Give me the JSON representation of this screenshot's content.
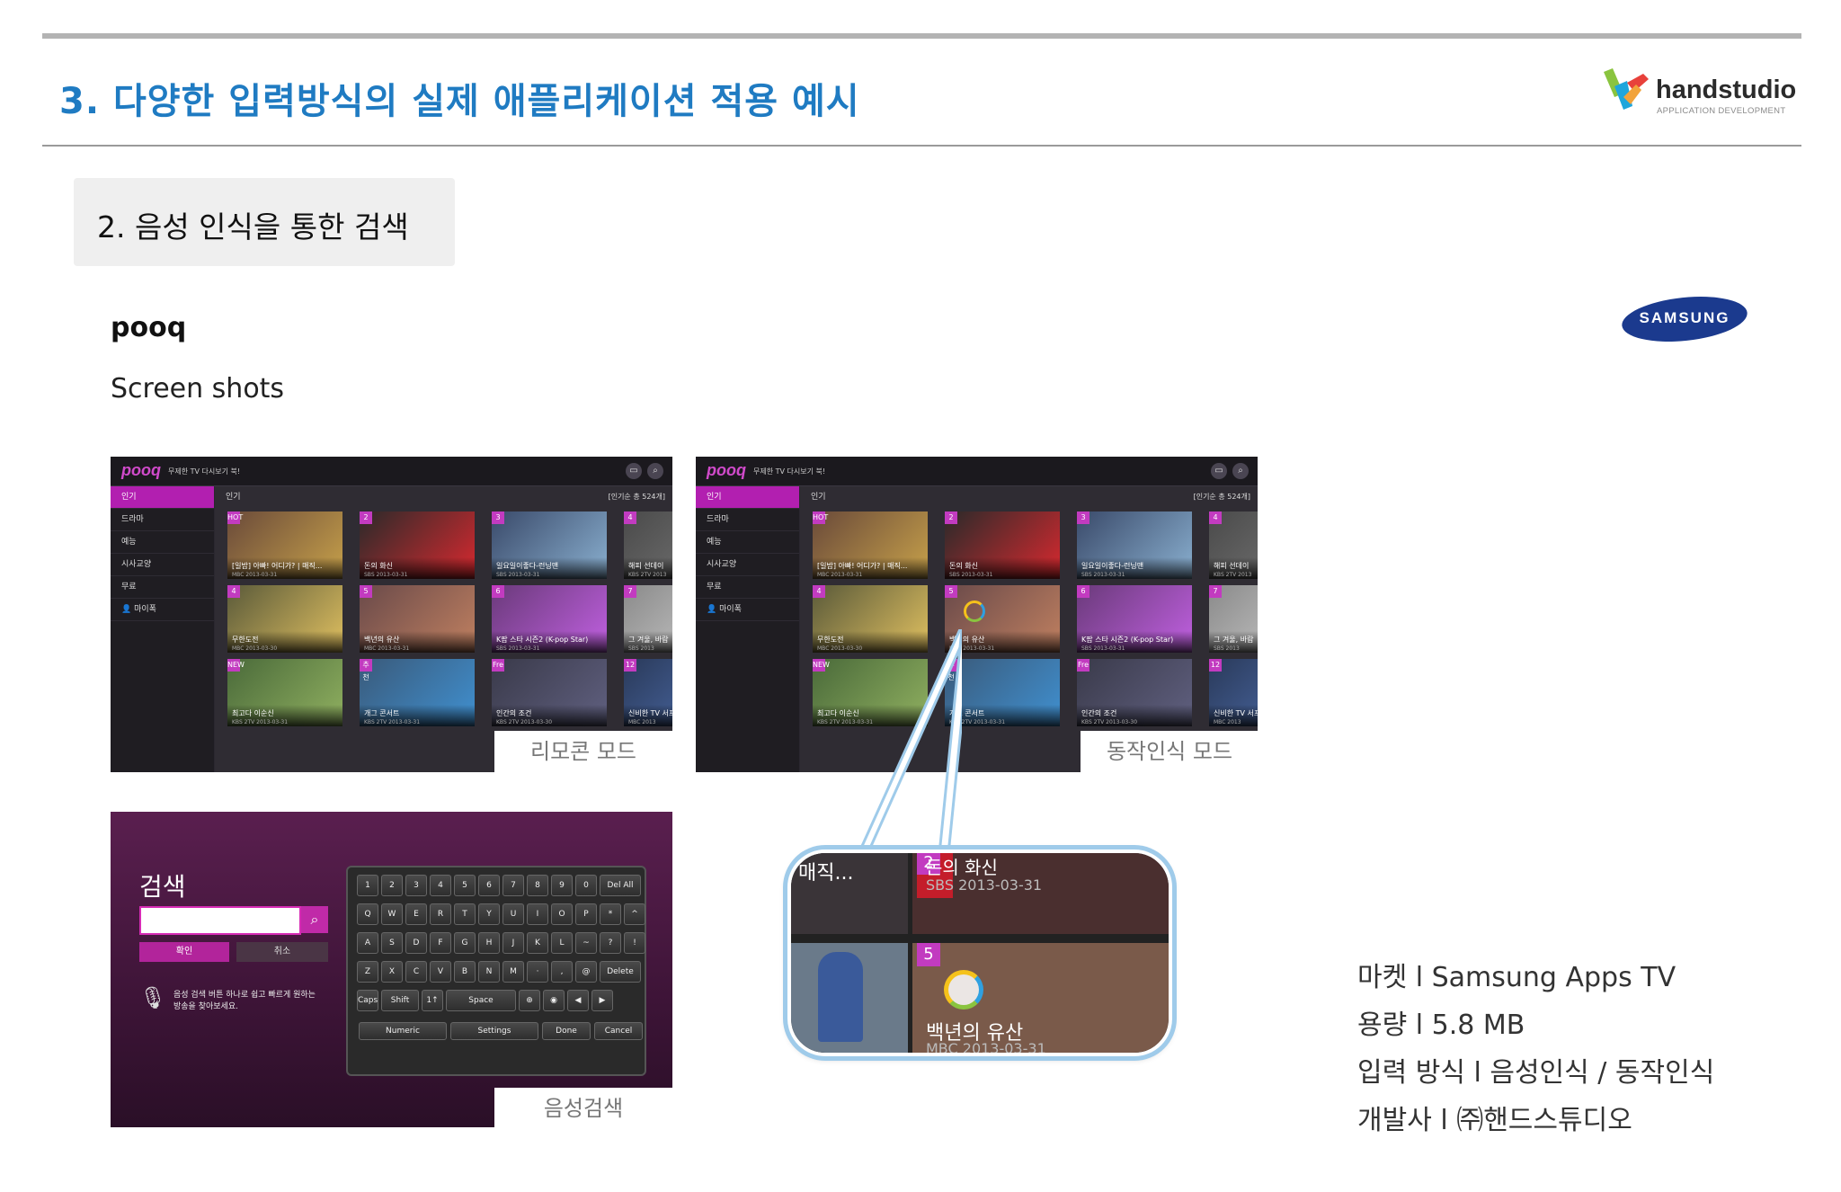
{
  "header": {
    "slide_title": "3. 다양한 입력방식의 실제 애플리케이션 적용 예시",
    "logo_name": "handstudio",
    "logo_sub": "APPLICATION DEVELOPMENT"
  },
  "section": {
    "title": "2. 음성 인식을 통한 검색"
  },
  "app": {
    "name": "pooq",
    "screenshots_label": "Screen shots",
    "brand": "SAMSUNG"
  },
  "tv": {
    "logo": "pooq",
    "tagline": "무제한 TV 다시보기 북!",
    "menu": [
      "인기",
      "드라마",
      "예능",
      "시사교양",
      "무료",
      "마이폭"
    ],
    "content_title": "인기",
    "count_label": "[인기순 총 524개]",
    "items": [
      {
        "title": "[일밤] 아빠! 어디가? | 매직...",
        "date": "MBC 2013-03-31",
        "badge": "HOT"
      },
      {
        "title": "돈의 화신",
        "date": "SBS 2013-03-31",
        "badge": "2"
      },
      {
        "title": "일요일이좋다-런닝맨",
        "date": "SBS 2013-03-31",
        "badge": "3"
      },
      {
        "title": "해피 선데이",
        "date": "KBS 2TV 2013",
        "badge": "4"
      },
      {
        "title": "무한도전",
        "date": "MBC 2013-03-30",
        "badge": "4"
      },
      {
        "title": "백년의 유산",
        "date": "MBC 2013-03-31",
        "badge": "5"
      },
      {
        "title": "K팝 스타 시즌2 (K-pop Star)",
        "date": "SBS 2013-03-31",
        "badge": "6"
      },
      {
        "title": "그 겨울, 바람",
        "date": "SBS 2013",
        "badge": "7"
      },
      {
        "title": "최고다 이순신",
        "date": "KBS 2TV 2013-03-31",
        "badge": "NEW"
      },
      {
        "title": "개그 콘서트",
        "date": "KBS 2TV 2013-03-31",
        "badge": "추천"
      },
      {
        "title": "인간의 조건",
        "date": "KBS 2TV 2013-03-30",
        "badge": "Free"
      },
      {
        "title": "신비한 TV 서프라이즈",
        "date": "MBC 2013",
        "badge": "12"
      }
    ]
  },
  "labels": {
    "remote": "리모콘 모드",
    "motion": "동작인식 모드",
    "voice": "음성검색"
  },
  "search": {
    "heading": "검색",
    "ok": "확인",
    "cancel": "취소",
    "hint": "음성 검색 버튼 하나로 쉽고 빠르게 원하는 방송을 찾아보세요.",
    "rows": [
      [
        "1",
        "2",
        "3",
        "4",
        "5",
        "6",
        "7",
        "8",
        "9",
        "0",
        "Del All"
      ],
      [
        "Q",
        "W",
        "E",
        "R",
        "T",
        "Y",
        "U",
        "I",
        "O",
        "P",
        "*",
        "^"
      ],
      [
        "A",
        "S",
        "D",
        "F",
        "G",
        "H",
        "J",
        "K",
        "L",
        "~",
        "?",
        "!"
      ],
      [
        "Z",
        "X",
        "C",
        "V",
        "B",
        "N",
        "M",
        "·",
        ",",
        "@",
        "Delete"
      ],
      [
        "Caps",
        "Shift",
        "1↑",
        "Space",
        "⊕",
        "◉",
        "◀",
        "▶"
      ],
      [
        "Numeric",
        "Settings",
        "Done",
        "Cancel"
      ]
    ]
  },
  "zoom": {
    "top_title": "돈의 화신",
    "top_date": "SBS 2013-03-31",
    "left_title": "매직...",
    "num_top": "2",
    "num_bottom": "5",
    "bottom_title": "백년의 유산",
    "bottom_date": "MBC 2013-03-31"
  },
  "info": [
    "마켓  l  Samsung Apps TV",
    "용량  l  5.8 MB",
    "입력 방식  l  음성인식 / 동작인식",
    "개발사 l  ㈜핸드스튜디오"
  ]
}
